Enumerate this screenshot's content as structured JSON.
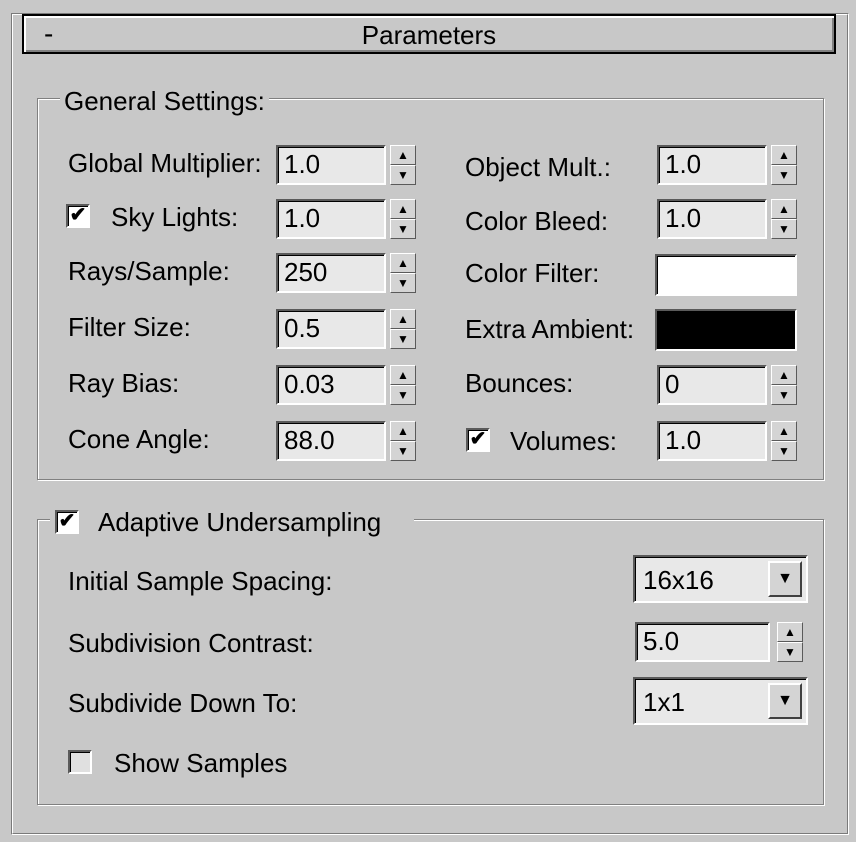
{
  "panel": {
    "title": "Parameters",
    "collapse_symbol": "-"
  },
  "general": {
    "legend": "General Settings:",
    "global_multiplier": {
      "label": "Global Multiplier:",
      "value": "1.0"
    },
    "sky_lights": {
      "label": "Sky Lights:",
      "value": "1.0",
      "checked": true
    },
    "rays_per_sample": {
      "label": "Rays/Sample:",
      "value": "250"
    },
    "filter_size": {
      "label": "Filter Size:",
      "value": "0.5"
    },
    "ray_bias": {
      "label": "Ray Bias:",
      "value": "0.03"
    },
    "cone_angle": {
      "label": "Cone Angle:",
      "value": "88.0"
    },
    "object_mult": {
      "label": "Object Mult.:",
      "value": "1.0"
    },
    "color_bleed": {
      "label": "Color Bleed:",
      "value": "1.0"
    },
    "color_filter": {
      "label": "Color Filter:",
      "color": "#ffffff"
    },
    "extra_ambient": {
      "label": "Extra Ambient:",
      "color": "#000000"
    },
    "bounces": {
      "label": "Bounces:",
      "value": "0"
    },
    "volumes": {
      "label": "Volumes:",
      "value": "1.0",
      "checked": true
    }
  },
  "adaptive": {
    "legend": "Adaptive Undersampling",
    "checked": true,
    "initial_sample_spacing": {
      "label": "Initial Sample Spacing:",
      "value": "16x16"
    },
    "subdivision_contrast": {
      "label": "Subdivision Contrast:",
      "value": "5.0"
    },
    "subdivide_down_to": {
      "label": "Subdivide Down To:",
      "value": "1x1"
    },
    "show_samples": {
      "label": "Show Samples",
      "checked": false
    }
  },
  "icons": {
    "check": "✔",
    "spin_up": "▲",
    "spin_down": "▼",
    "dropdown_arrow": "▼"
  }
}
